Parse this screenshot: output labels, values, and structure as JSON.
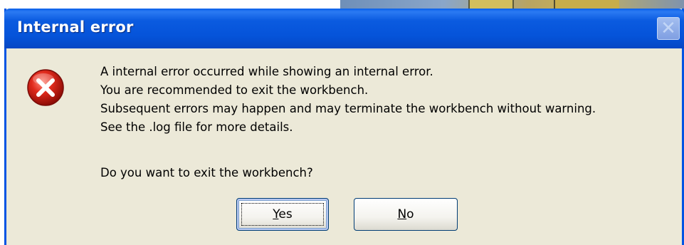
{
  "dialog": {
    "title": "Internal error",
    "close_symbol": "✕",
    "icon": "error-icon",
    "message_lines": [
      "A internal error occurred while showing an internal error.",
      "You are recommended to exit the workbench.",
      "Subsequent errors may happen and may terminate the workbench without warning.",
      "See the .log file for more details."
    ],
    "question": "Do you want to exit the workbench?",
    "buttons": {
      "yes": {
        "mnemonic": "Y",
        "rest": "es"
      },
      "no": {
        "mnemonic": "N",
        "rest": "o"
      }
    }
  },
  "colors": {
    "titlebar": "#0553d9",
    "dialog_bg": "#ece9d8",
    "error_red": "#d42020"
  }
}
